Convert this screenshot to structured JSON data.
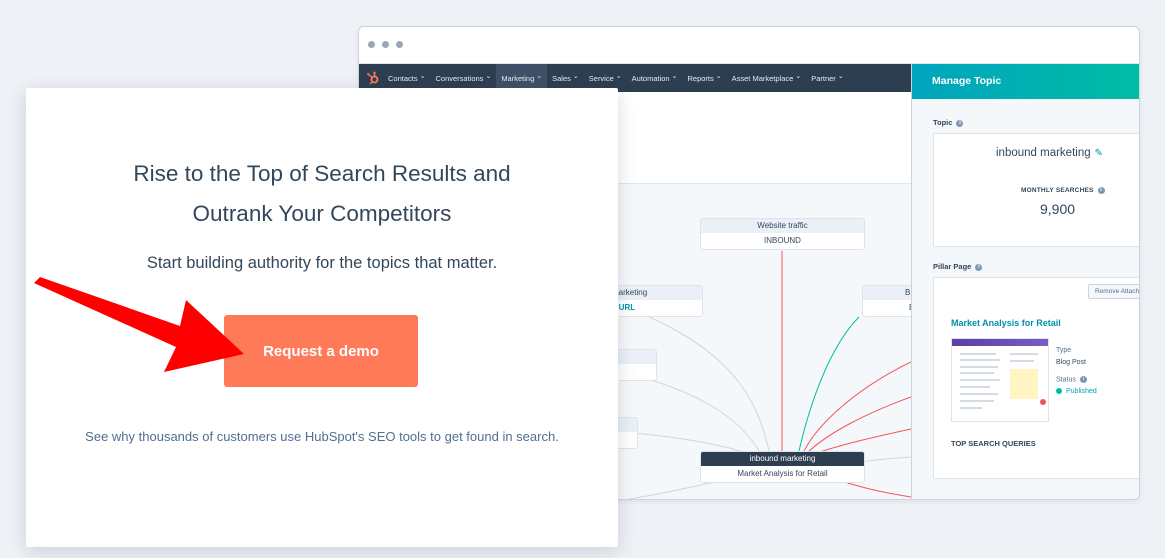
{
  "nav": {
    "items": [
      "Contacts",
      "Conversations",
      "Marketing",
      "Sales",
      "Service",
      "Automation",
      "Reports",
      "Asset Marketplace",
      "Partner"
    ],
    "active": "Marketing"
  },
  "panel": {
    "title": "Manage Topic",
    "topic_label": "Topic",
    "topic_value": "inbound marketing",
    "monthly_label": "MONTHLY SEARCHES",
    "monthly_value": "9,900",
    "pillar_label": "Pillar Page",
    "remove_label": "Remove Attach",
    "pillar_title": "Market Analysis for Retail",
    "type_label": "Type",
    "type_value": "Blog Post",
    "status_label": "Status",
    "status_value": "Published",
    "top_queries": "TOP SEARCH QUERIES"
  },
  "nodes": {
    "website_traffic": {
      "head": "Website traffic",
      "body": "INBOUND"
    },
    "left_node": {
      "head": "ound marketing",
      "body": "ontent URL"
    },
    "left_node2": {
      "head": "ng"
    },
    "right_node": {
      "head": "B",
      "body": "B"
    },
    "center": {
      "head": "inbound marketing",
      "body": "Market Analysis for Retail"
    }
  },
  "promo": {
    "title_line1": "Rise to the Top of Search Results and",
    "title_line2": "Outrank Your Competitors",
    "subtitle": "Start building authority for the topics that matter.",
    "cta_label": "Request a demo",
    "footer": "See why thousands of customers use HubSpot's SEO tools to get found in search."
  },
  "colors": {
    "cta": "#ff7a59",
    "nav": "#2d3e50",
    "panel_header": "#00a4bd",
    "arrow": "#ff0000",
    "link": "#0091ae"
  }
}
